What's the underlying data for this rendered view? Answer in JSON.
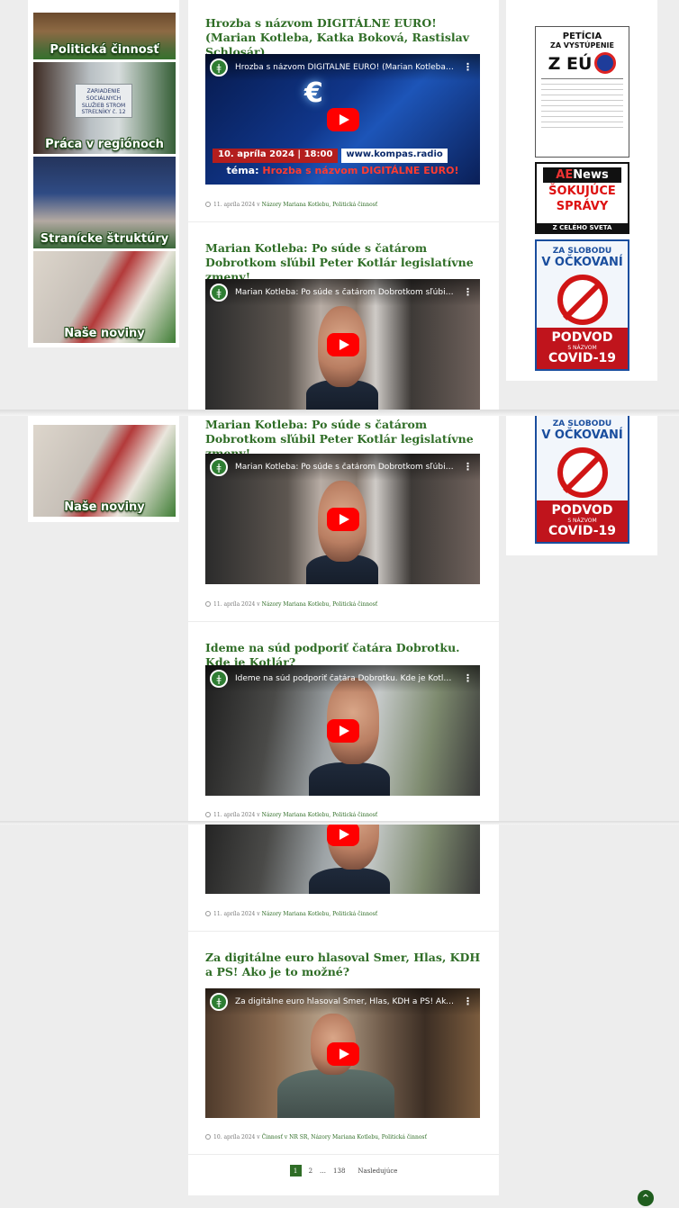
{
  "sidebar": {
    "banners": [
      "Politická činnosť",
      "Práca v regiónoch",
      "Stranícke štruktúry",
      "Naše noviny"
    ],
    "region_sign": "ZARIADENIE SOCIÁLNYCH SLUŽIEB STROM STREĽNÍKY č. 12"
  },
  "posts": [
    {
      "title": "Hrozba s názvom DIGITÁLNE EURO! (Marian Kotleba, Katka Boková, Rastislav Schlosár)",
      "video_title": "Hrozba s názvom DIGITÁLNE EURO! (Marian Kotleba, Kat...",
      "thumb_date": "10. apríla 2024 | 18:00",
      "thumb_site": "www.kompas.radio",
      "thumb_topic_prefix": "téma:",
      "thumb_topic": "Hrozba s názvom DIGITÁLNE EURO!",
      "date": "11. apríla 2024",
      "categories": "Názory Mariana Kotlebu, Politická činnosť"
    },
    {
      "title": "Marian Kotleba: Po súde s čatárom Dobrotkom sľúbil Peter Kotlár legislatívne zmeny!",
      "video_title": "Marian Kotleba: Po súde s čatárom Dobrotkom sľúbil Pet...",
      "date": "11. apríla 2024",
      "categories": "Názory Mariana Kotlebu, Politická činnosť"
    },
    {
      "title": "Ideme na súd podporiť čatára Dobrotku. Kde je Kotlár?",
      "video_title": "Ideme na súd podporiť čatára Dobrotku. Kde je Kotlár?",
      "date": "11. apríla 2024",
      "categories": "Názory Mariana Kotlebu, Politická činnosť"
    },
    {
      "title": "Za digitálne euro hlasoval Smer, Hlas, KDH a PS! Ako je to možné?",
      "video_title": "Za digitálne euro hlasoval Smer, Hlas, KDH a PS! Ako je t...",
      "date": "10. apríla 2024",
      "categories": "Činnosť v NR SR, Názory Mariana Kotlebu, Politická činnosť"
    }
  ],
  "meta_in": "v",
  "pagination": {
    "current": "1",
    "page2": "2",
    "dots": "…",
    "last": "138",
    "next": "Nasledujúce"
  },
  "right_sidebar": {
    "petition": {
      "line1": "PETÍCIA",
      "line2": "ZA VYSTÚPENIE",
      "line3": "Z EÚ"
    },
    "aenews": {
      "logo_a": "AE",
      "logo_b": "News",
      "line1": "ŠOKUJÚCE",
      "line2": "SPRÁVY",
      "line3": "Z CELÉHO SVETA"
    },
    "vax": {
      "line1": "ZA SLOBODU",
      "line2": "V OČKOVANÍ",
      "red1": "PODVOD",
      "red2": "S NÁZVOM",
      "red3": "COVID-19"
    }
  },
  "colors": {
    "accent": "#2f6d26",
    "youtube": "#ff0000",
    "background": "#ededed"
  }
}
